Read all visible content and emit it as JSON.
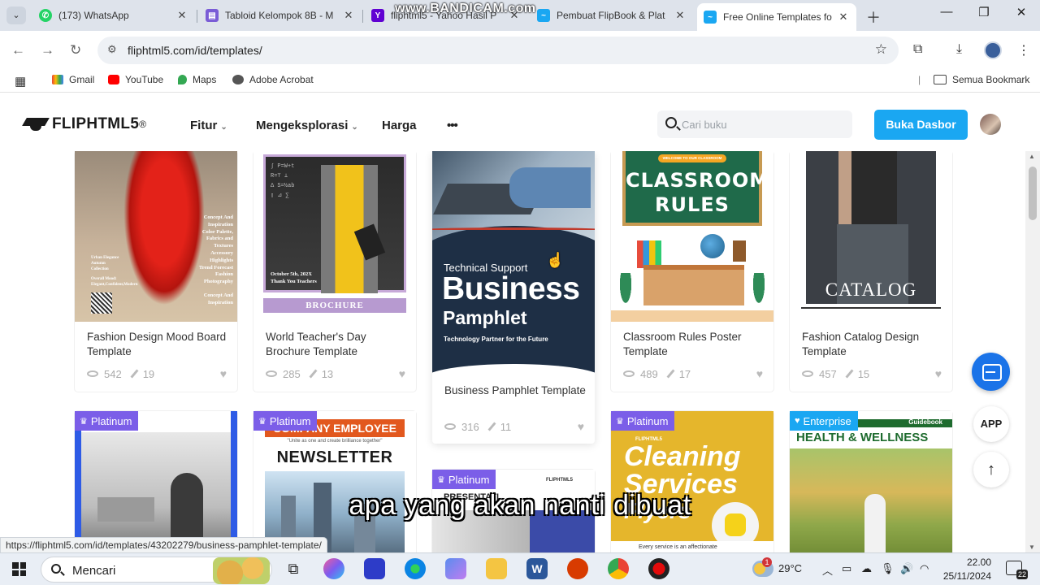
{
  "browser": {
    "tabs": [
      {
        "title": "(173) WhatsApp",
        "color": "#25d366"
      },
      {
        "title": "Tabloid Kelompok 8B - M",
        "color": "#7a5cd6"
      },
      {
        "title": "fliphtml5 - Yahoo Hasil P",
        "color": "#6001d2"
      },
      {
        "title": "Pembuat FlipBook & Plat",
        "color": "#1aa7f2"
      },
      {
        "title": "Free Online Templates fo",
        "color": "#1aa7f2"
      }
    ],
    "url": "fliphtml5.com/id/templates/",
    "bookmarks": [
      "Gmail",
      "YouTube",
      "Maps",
      "Adobe Acrobat"
    ],
    "all_bookmarks": "Semua Bookmark",
    "recorder_watermark": "www.BANDICAM.com"
  },
  "site": {
    "logo": "FLIPHTML5",
    "logo_mark": "®",
    "nav": [
      "Fitur",
      "Mengeksplorasi",
      "Harga"
    ],
    "more": "•••",
    "search_placeholder": "Cari buku",
    "cta": "Buka Dasbor",
    "accent": "#1aa7f2"
  },
  "cards": [
    {
      "title": "Fashion Design Mood Board Template",
      "views": "542",
      "edits": "19",
      "thumb_text": {
        "lines": [
          "Concept And",
          "Inspiration",
          "Color Palette,",
          "Fabrics and",
          "Textures",
          "Accessory",
          "Highlights",
          "Trend Forecast",
          "Fashion",
          "Photography",
          "Concept And",
          "Inspiration"
        ],
        "left": [
          "Urban Elegance",
          "Autumn",
          "Collection",
          "Overall Mood:",
          "Elegant,Confident,Modern"
        ]
      }
    },
    {
      "title": "World Teacher's Day Brochure Template",
      "views": "285",
      "edits": "13",
      "thumb_text": {
        "date": "October 5th, 202X",
        "thanks": "Thank You Teachers",
        "brochure": "BROCHURE"
      }
    },
    {
      "title": "Business Pamphlet Template",
      "views": "316",
      "edits": "11",
      "thumb_text": {
        "kicker": "Technical Support",
        "big": "Business",
        "mid": "Pamphlet",
        "tag": "Technology Partner for the Future"
      }
    },
    {
      "title": "Classroom Rules Poster Template",
      "views": "489",
      "edits": "17",
      "thumb_text": {
        "welcome": "WELCOME TO OUR CLASSROOM",
        "l1": "CLASSROOM",
        "l2": "RULES"
      }
    },
    {
      "title": "Fashion Catalog Design Template",
      "views": "457",
      "edits": "15",
      "thumb_text": {
        "catalog": "CATALOG"
      }
    }
  ],
  "row2": [
    {
      "badge": "Platinum"
    },
    {
      "badge": "Platinum",
      "thumb_text": {
        "l1": "COMPANY EMPLOYEE",
        "sub": "\"Unite as one and create brilliance together\"",
        "l2": "NEWSLETTER"
      }
    },
    {
      "badge": "Platinum",
      "thumb_text": {
        "brand": "FLIPHTML5",
        "l1": "PRESENTATI"
      }
    },
    {
      "badge": "Platinum",
      "thumb_text": {
        "brand": "FLIPHTML5",
        "l1": "Cleaning",
        "l2": "Services",
        "l3": "Flyers",
        "foot": "Every service is an affectionate"
      }
    },
    {
      "badge": "Enterprise",
      "thumb_text": {
        "tag": "Guidebook",
        "l1": "HEALTH & WELLNESS"
      }
    }
  ],
  "floating": {
    "app": "APP"
  },
  "status_url": "https://fliphtml5.com/id/templates/43202279/business-pamphlet-template/",
  "subtitle": "apa yang akan nanti dibuat",
  "taskbar": {
    "search": "Mencari",
    "weather": "29°C",
    "weather_alert": "1",
    "time": "22.00",
    "date": "25/11/2024",
    "notifications": "22"
  }
}
